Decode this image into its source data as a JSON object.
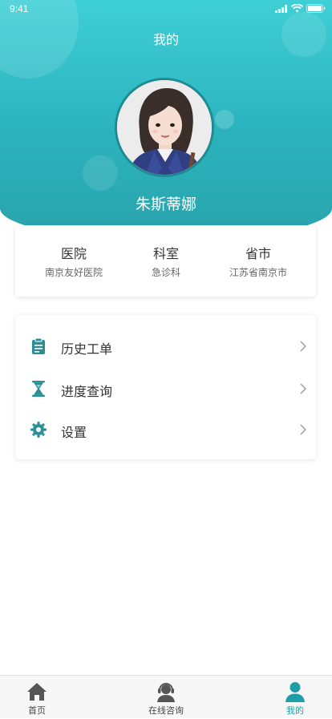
{
  "status_bar": {
    "time": "9:41"
  },
  "header": {
    "title": "我的"
  },
  "profile": {
    "name": "朱斯蒂娜"
  },
  "info": [
    {
      "label": "医院",
      "value": "南京友好医院"
    },
    {
      "label": "科室",
      "value": "急诊科"
    },
    {
      "label": "省市",
      "value": "江苏省南京市"
    }
  ],
  "menu": [
    {
      "label": "历史工单",
      "icon": "clipboard-icon"
    },
    {
      "label": "进度查询",
      "icon": "hourglass-icon"
    },
    {
      "label": "设置",
      "icon": "gear-icon"
    }
  ],
  "tabbar": [
    {
      "label": "首页",
      "icon": "home-icon",
      "active": false
    },
    {
      "label": "在线咨询",
      "icon": "headset-icon",
      "active": false
    },
    {
      "label": "我的",
      "icon": "person-icon",
      "active": true
    }
  ],
  "colors": {
    "accent": "#1f9ea8",
    "header_top": "#3fcfd6",
    "header_bottom": "#2aa3ac"
  }
}
